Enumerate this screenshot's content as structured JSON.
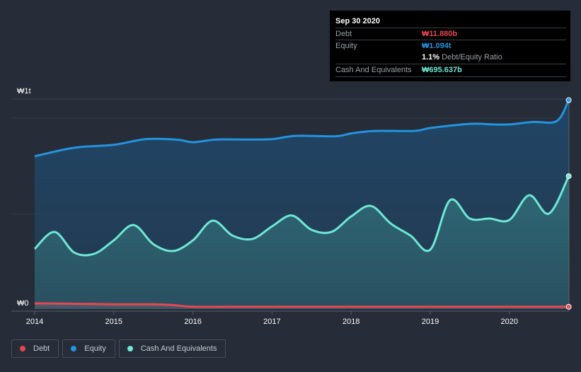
{
  "chart_data": {
    "type": "area",
    "ylim": [
      0,
      1.1
    ],
    "y_ticks": [
      {
        "value": 0,
        "label": "₩0"
      },
      {
        "value": 1,
        "label": "₩1t"
      }
    ],
    "x_ticks": [
      "2014",
      "2015",
      "2016",
      "2017",
      "2018",
      "2019",
      "2020"
    ],
    "xlim": [
      2013.8,
      2020.9
    ],
    "legend_position": "bottom-left",
    "series": [
      {
        "name": "Debt",
        "color": "#e8474f",
        "unit": "trillion ₩",
        "x": [
          2014,
          2014.5,
          2015,
          2015.5,
          2015.75,
          2016,
          2016.5,
          2017,
          2018,
          2019,
          2020,
          2020.75
        ],
        "values": [
          0.03,
          0.028,
          0.025,
          0.025,
          0.021,
          0.012,
          0.012,
          0.012,
          0.012,
          0.012,
          0.012,
          0.012
        ]
      },
      {
        "name": "Equity",
        "color": "#2394df",
        "unit": "trillion ₩",
        "x": [
          2014,
          2014.5,
          2015,
          2015.4,
          2015.8,
          2016,
          2016.3,
          2016.7,
          2017,
          2017.3,
          2017.8,
          2018,
          2018.3,
          2018.8,
          2019,
          2019.5,
          2019.8,
          2020,
          2020.3,
          2020.6,
          2020.75
        ],
        "values": [
          0.8,
          0.845,
          0.86,
          0.89,
          0.887,
          0.874,
          0.888,
          0.888,
          0.89,
          0.907,
          0.905,
          0.92,
          0.933,
          0.933,
          0.948,
          0.97,
          0.967,
          0.967,
          0.98,
          0.985,
          1.094
        ]
      },
      {
        "name": "Cash And Equivalents",
        "color": "#6ee8d5",
        "unit": "trillion ₩",
        "x": [
          2014,
          2014.25,
          2014.5,
          2014.75,
          2015,
          2015.25,
          2015.5,
          2015.75,
          2016,
          2016.25,
          2016.5,
          2016.75,
          2017,
          2017.25,
          2017.5,
          2017.75,
          2018,
          2018.25,
          2018.5,
          2018.75,
          2019,
          2019.25,
          2019.5,
          2019.75,
          2020,
          2020.25,
          2020.5,
          2020.75
        ],
        "values": [
          0.315,
          0.404,
          0.296,
          0.289,
          0.36,
          0.44,
          0.34,
          0.304,
          0.36,
          0.463,
          0.385,
          0.367,
          0.433,
          0.49,
          0.415,
          0.404,
          0.485,
          0.54,
          0.448,
          0.385,
          0.311,
          0.57,
          0.474,
          0.474,
          0.467,
          0.596,
          0.5,
          0.696
        ]
      }
    ]
  },
  "tooltip": {
    "date": "Sep 30 2020",
    "debt_label": "Debt",
    "debt_value": "₩11.880b",
    "equity_label": "Equity",
    "equity_value": "₩1.094t",
    "ratio_value": "1.1%",
    "ratio_label": "Debt/Equity Ratio",
    "cash_label": "Cash And Equivalents",
    "cash_value": "₩695.637b"
  },
  "legend": [
    {
      "label": "Debt",
      "color": "#e8474f"
    },
    {
      "label": "Equity",
      "color": "#2394df"
    },
    {
      "label": "Cash And Equivalents",
      "color": "#6ee8d5"
    }
  ]
}
